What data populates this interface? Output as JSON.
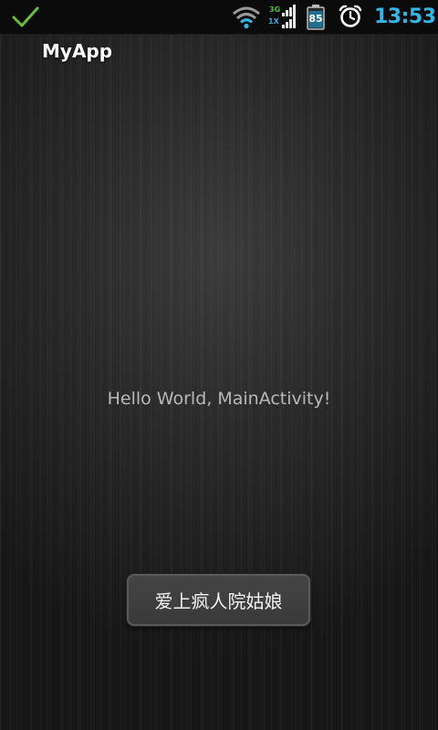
{
  "status_bar": {
    "notification_icon": "check-icon",
    "wifi_icon": "wifi-icon",
    "network_type_top": "3G",
    "network_type_bottom": "1X",
    "signal_icon": "signal-icon",
    "battery_level": "85",
    "alarm_icon": "alarm-clock-icon",
    "time": "13:53",
    "clock_color": "#33b5e5",
    "check_color": "#6abf3a"
  },
  "app": {
    "title": "MyApp"
  },
  "content": {
    "message": "Hello World, MainActivity!"
  },
  "toast": {
    "text": "爱上疯人院姑娘"
  }
}
